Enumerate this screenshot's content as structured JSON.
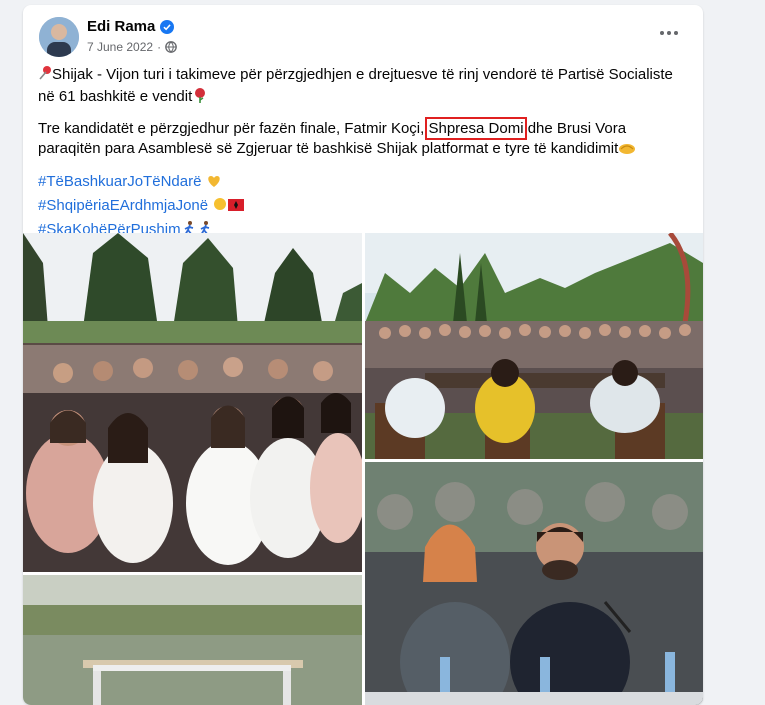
{
  "post": {
    "author": "Edi Rama",
    "date": "7 June 2022",
    "visibility_icon": "globe-icon",
    "more_icon": "more-options-icon",
    "paragraph1": "Shijak - Vijon turi i takimeve për përzgjedhjen e drejtuesve të rinj vendorë të Partisë Socialiste në 61 bashkitë e vendit",
    "paragraph2_before": "Tre kandidatët e përzgjedhur për fazën finale, Fatmir Koçi, ",
    "paragraph2_highlight": "Shpresa Domi",
    "paragraph2_after": " dhe Brusi Vora paraqitën para Asamblesë së Zgjeruar të bashkisë Shijak platformat e tyre të kandidimit",
    "hashtags": [
      "#TëBashkuarJoTëNdarë",
      "#ShqipëriaEArdhmjaJonë",
      "#SkaKohëPërPushim"
    ],
    "colors": {
      "link": "#216fdb",
      "highlight": "#e02020",
      "verified": "#1877f2"
    }
  }
}
